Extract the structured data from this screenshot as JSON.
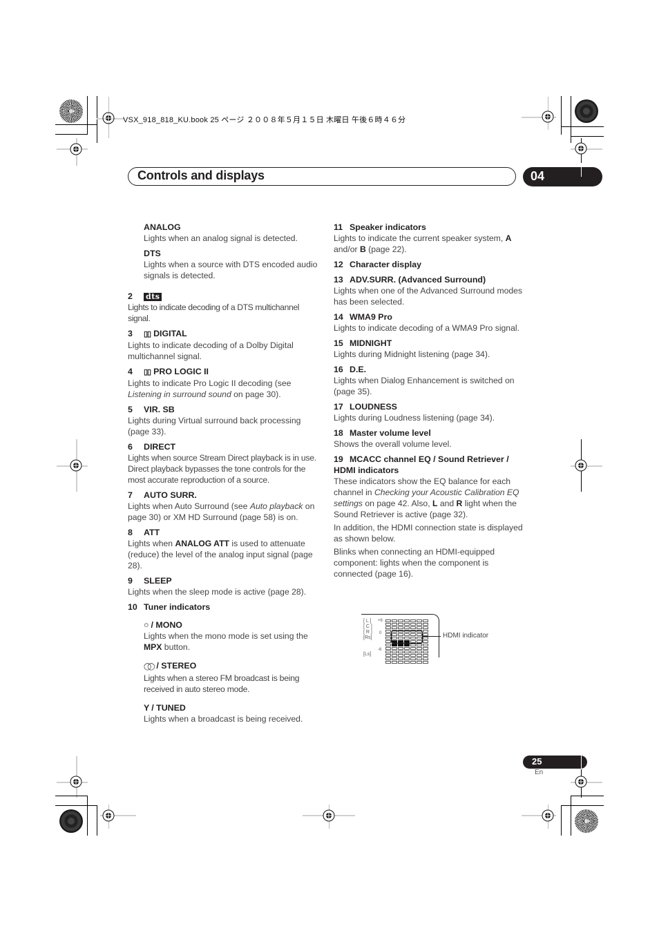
{
  "slug": "VSX_918_818_KU.book  25 ページ  ２００８年５月１５日  木曜日  午後６時４６分",
  "header": {
    "title": "Controls and displays",
    "chapter": "04"
  },
  "left_column": {
    "analog": {
      "title": "ANALOG",
      "desc": "Lights when an analog signal is detected."
    },
    "dts": {
      "title": "DTS",
      "desc": "Lights when a source with DTS encoded audio signals is detected."
    },
    "items": [
      {
        "num": "2",
        "logo": "dts",
        "desc": "Lights to indicate decoding of a DTS multichannel signal."
      },
      {
        "num": "3",
        "icon": "dolby-icon",
        "title": "DIGITAL",
        "desc": "Lights to indicate decoding of a Dolby Digital multichannel signal."
      },
      {
        "num": "4",
        "icon": "dolby-icon",
        "title": "PRO LOGIC II",
        "desc_pre": "Lights to indicate Pro Logic II decoding (see ",
        "desc_em": "Listening in surround sound",
        "desc_post": " on page 30)."
      },
      {
        "num": "5",
        "title": "VIR. SB",
        "desc": "Lights during Virtual surround back processing (page 33)."
      },
      {
        "num": "6",
        "title": "DIRECT",
        "desc": "Lights when source Stream Direct playback is in use. Direct playback bypasses the tone controls for the most accurate reproduction of a source."
      },
      {
        "num": "7",
        "title": "AUTO SURR.",
        "desc_pre": "Lights when Auto Surround (see ",
        "desc_em": "Auto playback",
        "desc_post": " on page 30) or XM HD Surround (page 58) is on."
      },
      {
        "num": "8",
        "title": "ATT",
        "desc_pre": "Lights when ",
        "desc_bold": "ANALOG ATT",
        "desc_post": " is used to attenuate (reduce) the level of the analog input signal (page 28)."
      },
      {
        "num": "9",
        "title": "SLEEP",
        "desc": "Lights when the sleep mode is active (page 28)."
      },
      {
        "num": "10",
        "title": "Tuner indicators"
      }
    ],
    "tuner": [
      {
        "icon": "mono-icon",
        "symbol": "○",
        "title": "/ MONO",
        "desc_pre": "Lights when the mono mode is set using the ",
        "desc_bold": "MPX",
        "desc_post": " button."
      },
      {
        "icon": "stereo-icon",
        "symbol": "◯◯",
        "title": "/ STEREO",
        "desc": "Lights when a stereo FM broadcast is being received in auto stereo mode."
      },
      {
        "icon": "tuned-icon",
        "symbol": "Y",
        "title": "/ TUNED",
        "desc": "Lights when a broadcast is being received."
      }
    ]
  },
  "right_column": {
    "items": [
      {
        "num": "11",
        "title": "Speaker indicators",
        "desc": "Lights to indicate the current speaker system, ",
        "bold_a": "A",
        "mid": " and/or ",
        "bold_b": "B",
        "post": " (page 22)."
      },
      {
        "num": "12",
        "title": "Character display"
      },
      {
        "num": "13",
        "title": "ADV.SURR. (Advanced Surround)",
        "desc": "Lights when one of the Advanced Surround modes has been selected."
      },
      {
        "num": "14",
        "title": "WMA9 Pro",
        "desc": "Lights to indicate decoding of a WMA9 Pro signal."
      },
      {
        "num": "15",
        "title": "MIDNIGHT",
        "desc": "Lights during Midnight listening (page 34)."
      },
      {
        "num": "16",
        "title": "D.E.",
        "desc": "Lights when Dialog Enhancement is switched on (page 35)."
      },
      {
        "num": "17",
        "title": "LOUDNESS",
        "desc": "Lights during Loudness listening (page 34)."
      },
      {
        "num": "18",
        "title": "Master volume level",
        "desc": "Shows the overall volume level."
      },
      {
        "num": "19",
        "title": "MCACC channel EQ / Sound Retriever / HDMI indicators",
        "p1_pre": "These indicators show the EQ balance for each channel in ",
        "p1_em": "Checking your Acoustic Calibration EQ settings",
        "p1_mid": " on page 42. Also, ",
        "p1_bold_l": "L",
        "p1_and": " and ",
        "p1_bold_r": "R",
        "p1_post": " light when the Sound Retriever is active (page 32).",
        "p2": "In addition, the HDMI connection state is displayed as shown below.",
        "p3": "Blinks when connecting an HDMI-equipped component: lights when the component is connected (page 16)."
      }
    ]
  },
  "figure": {
    "channel_labels": [
      "[ L ]",
      "[ C ]",
      "[ R ]",
      "[Rs]",
      "",
      "",
      "[Ls]"
    ],
    "scale_top": "+6",
    "scale_mid": "0",
    "scale_bottom": "-6",
    "callout": "HDMI indicator"
  },
  "footer": {
    "page_number": "25",
    "language": "En"
  }
}
